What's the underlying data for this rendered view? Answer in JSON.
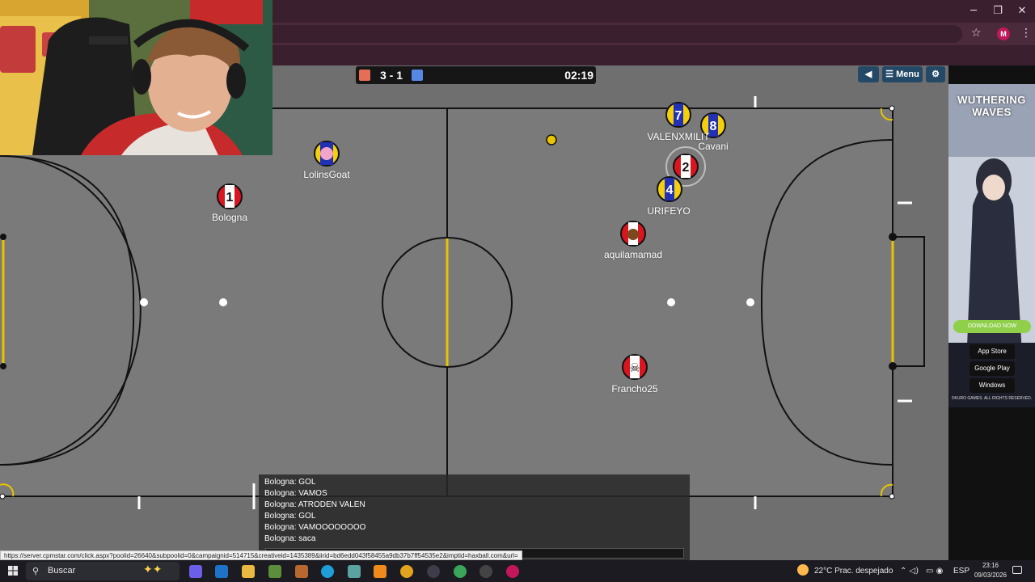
{
  "browser": {
    "minimize_icon": "minimize-icon",
    "maximize_icon": "restore-icon",
    "close_icon": "close-icon",
    "star_icon": "star-icon",
    "profile_initial": "M",
    "menu_icon": "more-vert-icon"
  },
  "game": {
    "score": "3 - 1",
    "timer": "02:19",
    "menu_label": "☰ Menu",
    "colors": {
      "red_team": "#e56e56",
      "blue_team": "#5689e5",
      "pitch": "#7e7e7e",
      "lines": "#111111",
      "goal_line": "#e8c300"
    },
    "players": [
      {
        "name": "LolinsGoat",
        "team": "blue",
        "avatar": ""
      },
      {
        "name": "Bologna",
        "team": "red",
        "avatar": "1"
      },
      {
        "name": "VALENXMILIT",
        "team": "blue",
        "avatar": "7"
      },
      {
        "name": "Cavani",
        "team": "blue",
        "avatar": "8"
      },
      {
        "name": "",
        "team": "red",
        "avatar": "2"
      },
      {
        "name": "URIFEYO",
        "team": "blue",
        "avatar": "4"
      },
      {
        "name": "aquilamamad",
        "team": "red",
        "avatar": ""
      },
      {
        "name": "Francho25",
        "team": "red",
        "avatar": "☠"
      }
    ]
  },
  "chat": {
    "messages": [
      "Bologna: GOL",
      "Bologna: VAMOS",
      "Bologna: ATRODEN VALEN",
      "Bologna: GOL",
      "Bologna: VAMOOOOOOOO",
      "Bologna: saca"
    ]
  },
  "status_url": "https://server.cpmstar.com/click.aspx?poolid=26640&subpoolid=0&campaignid=514715&creativeid=1435389&iirid=bd6edd043f58455a9db37b7ff54535e2&imptid=haxball.com&url=",
  "ad": {
    "title_line1": "WUTHERING",
    "title_line2": "WAVES",
    "download_label": "DOWNLOAD NOW",
    "app_store": "App Store",
    "google_play": "Google Play",
    "windows": "Windows",
    "copyright": "©KURO GAMES. ALL RIGHTS RESERVED."
  },
  "taskbar": {
    "search_placeholder": "Buscar",
    "weather": "22°C  Prac. despejado",
    "language": "ESP",
    "time": "23:16",
    "date": "09/03/2026"
  }
}
